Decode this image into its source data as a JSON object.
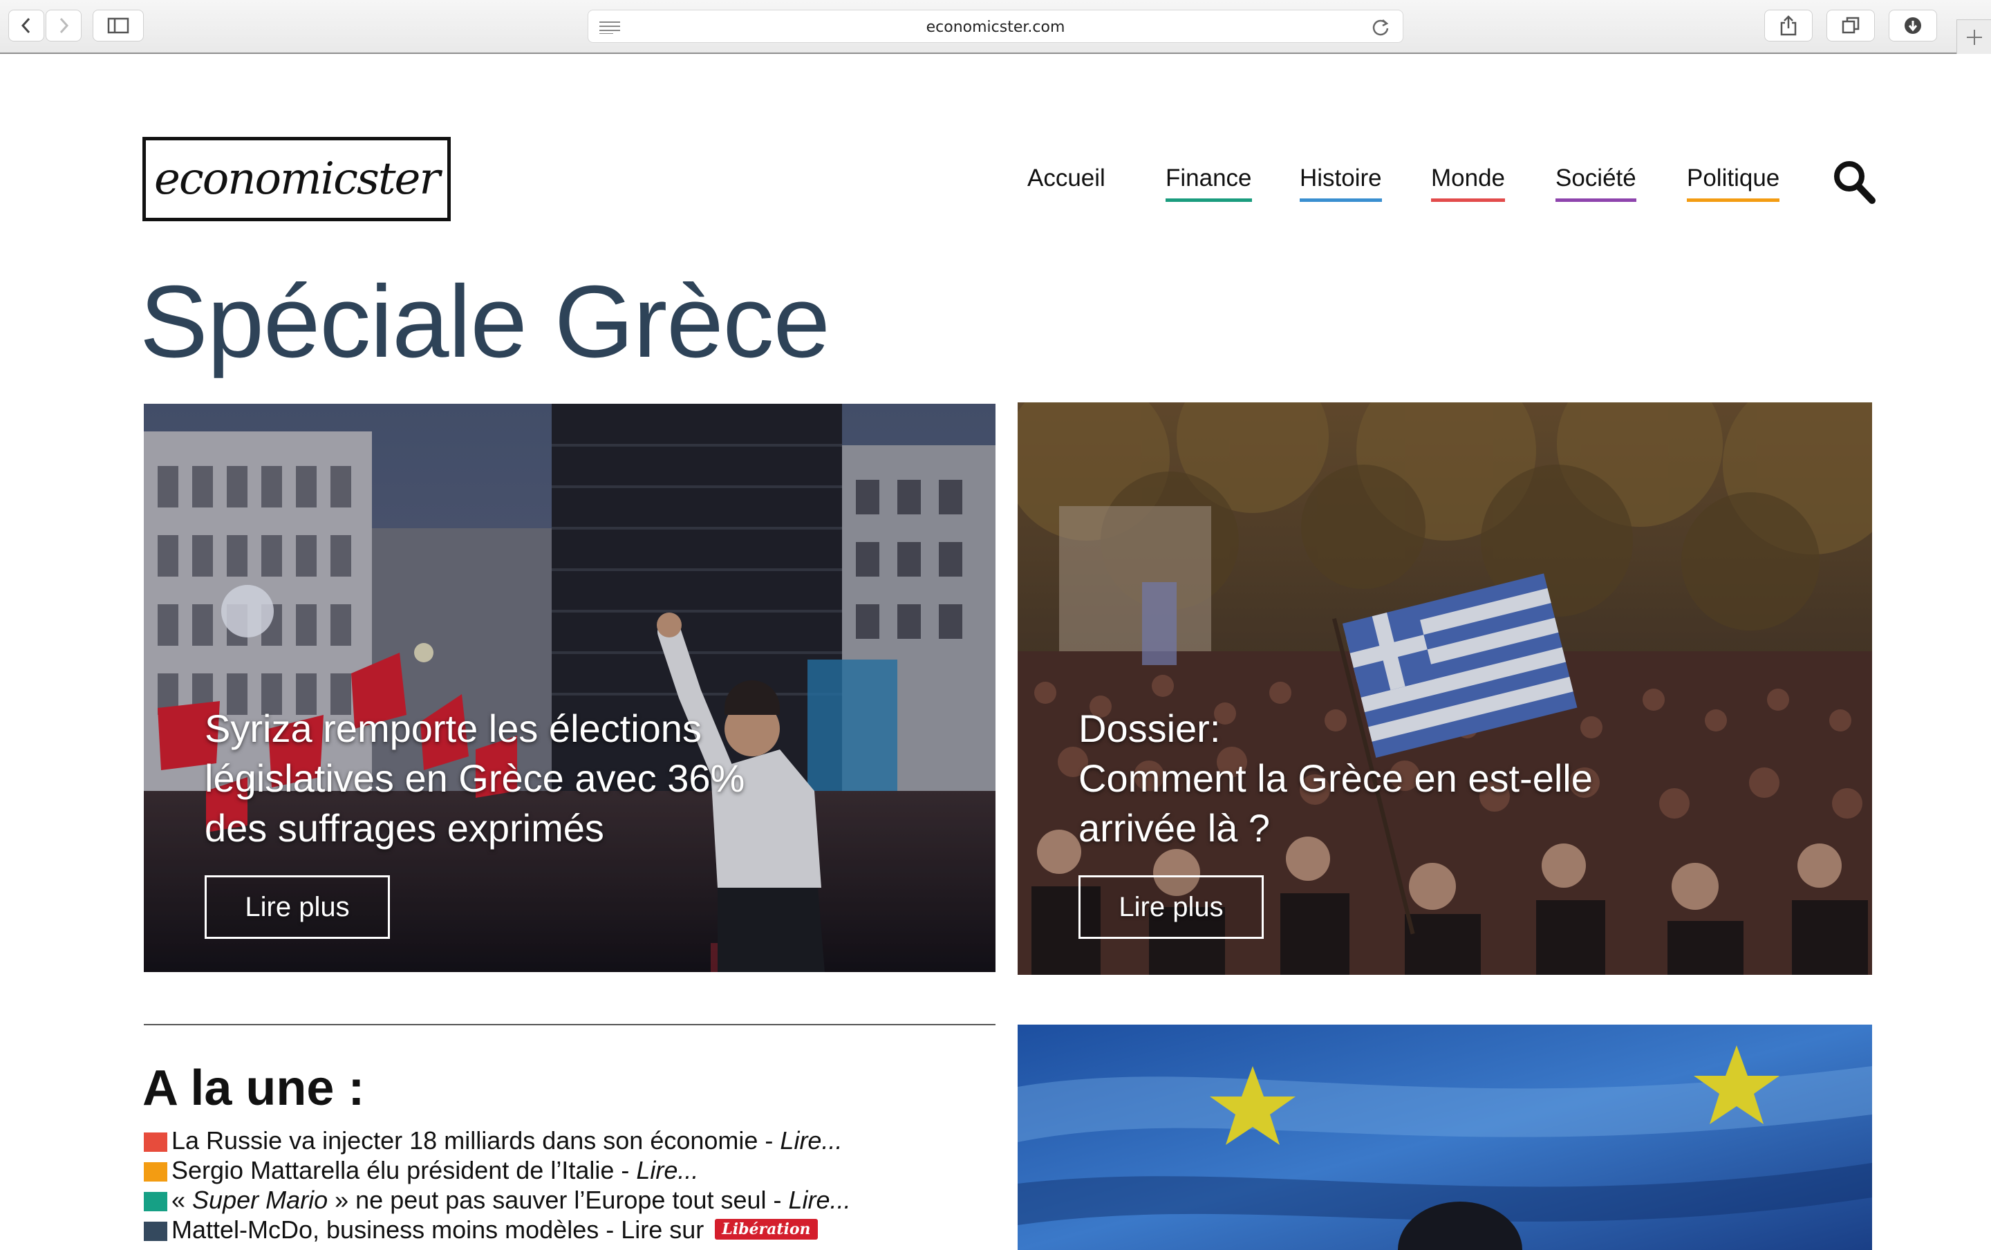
{
  "browser": {
    "url": "economicster.com"
  },
  "site": {
    "logo_text": "economicster",
    "nav": [
      {
        "label": "Accueil",
        "color": ""
      },
      {
        "label": "Finance",
        "color": "#1a9c7e"
      },
      {
        "label": "Histoire",
        "color": "#3a8fd0"
      },
      {
        "label": "Monde",
        "color": "#e24b4b"
      },
      {
        "label": "Société",
        "color": "#8e44ad"
      },
      {
        "label": "Politique",
        "color": "#f39c12"
      }
    ]
  },
  "page": {
    "title": "Spéciale Grèce"
  },
  "features": [
    {
      "title": "Syriza  remporte  les  élections\nlégislatives en Grèce avec 36%\ndes suffrages exprimés",
      "button": "Lire plus"
    },
    {
      "title": "Dossier:\nComment la Grèce en est-elle\narrivée là ?",
      "button": "Lire plus"
    }
  ],
  "une": {
    "title": "A la une :",
    "items": [
      {
        "color": "#e74c3c",
        "text": "La Russie va injecter 18 milliards dans son économie - ",
        "link": "Lire..."
      },
      {
        "color": "#f39c12",
        "text": "Sergio Mattarella élu président de l’Italie - ",
        "link": "Lire..."
      },
      {
        "color": "#16a085",
        "prefix": "« ",
        "em": "Super Mario",
        "text": " » ne peut pas sauver l’Europe tout seul - ",
        "link": "Lire..."
      },
      {
        "color": "#34495e",
        "text": "Mattel-McDo, business moins modèles - Lire sur ",
        "badge": "Libération"
      }
    ]
  }
}
